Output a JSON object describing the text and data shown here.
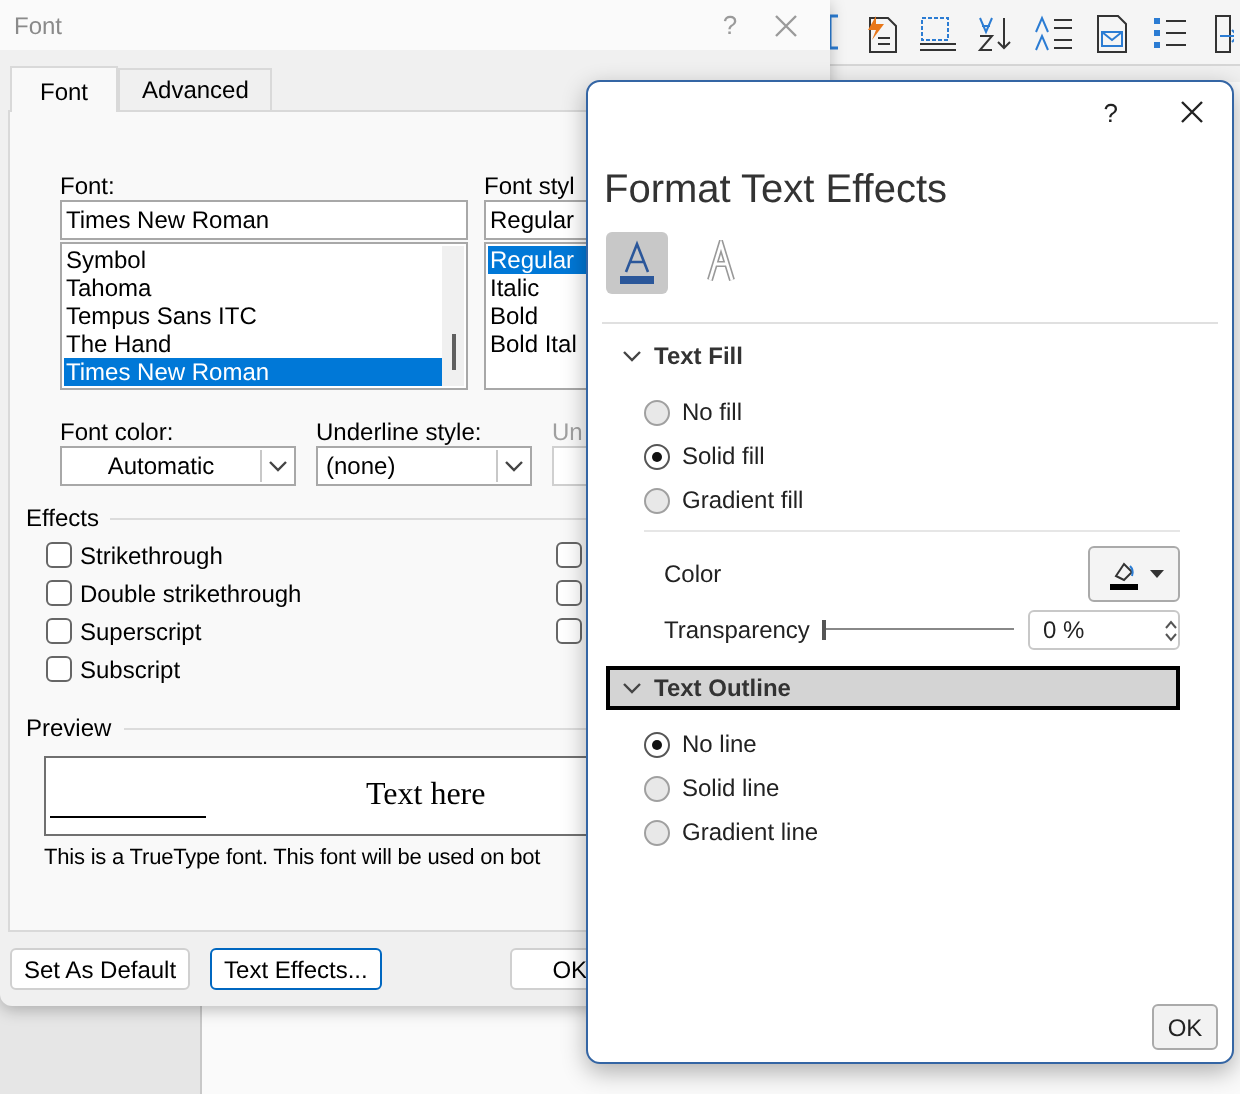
{
  "font_dialog": {
    "title": "Font",
    "help": "?",
    "tabs": [
      {
        "label": "Font",
        "selected": true
      },
      {
        "label": "Advanced",
        "selected": false
      }
    ],
    "font": {
      "label": "Font:",
      "value": "Times New Roman",
      "items": [
        {
          "label": "Symbol",
          "selected": false
        },
        {
          "label": "Tahoma",
          "selected": false
        },
        {
          "label": "Tempus Sans ITC",
          "selected": false
        },
        {
          "label": "The Hand",
          "selected": false
        },
        {
          "label": "Times New Roman",
          "selected": true
        }
      ]
    },
    "font_style": {
      "label": "Font styl",
      "value": "Regular",
      "items": [
        {
          "label": "Regular",
          "selected": true
        },
        {
          "label": "Italic",
          "selected": false
        },
        {
          "label": "Bold",
          "selected": false
        },
        {
          "label": "Bold Ital",
          "selected": false
        }
      ]
    },
    "font_color": {
      "label": "Font color:",
      "value": "Automatic"
    },
    "underline_style": {
      "label": "Underline style:",
      "value": "(none)"
    },
    "underline_color": {
      "label": "Un",
      "disabled": true
    },
    "effects": {
      "title": "Effects",
      "items": [
        {
          "label": "Strikethrough",
          "checked": false
        },
        {
          "label": "Double strikethrough",
          "checked": false
        },
        {
          "label": "Superscript",
          "checked": false
        },
        {
          "label": "Subscript",
          "checked": false
        }
      ],
      "right_items": [
        {
          "checked": false
        },
        {
          "checked": false
        },
        {
          "checked": false
        }
      ]
    },
    "preview": {
      "title": "Preview",
      "sample": "Text here",
      "note": "This is a TrueType font. This font will be used on bot"
    },
    "buttons": [
      {
        "label": "Set As Default",
        "focused": false
      },
      {
        "label": "Text Effects...",
        "focused": true
      },
      {
        "label": "OK",
        "focused": false
      }
    ]
  },
  "effects_pane": {
    "help": "?",
    "title": "Format Text Effects",
    "tabs": [
      {
        "kind": "fill",
        "selected": true
      },
      {
        "kind": "outline",
        "selected": false
      }
    ],
    "sections": [
      {
        "title": "Text Fill",
        "expanded": true,
        "focused": false,
        "options": [
          {
            "label": "No fill",
            "selected": false
          },
          {
            "label": "Solid fill",
            "selected": true
          },
          {
            "label": "Gradient fill",
            "selected": false
          }
        ],
        "color": {
          "label": "Color"
        },
        "transparency": {
          "label": "Transparency",
          "level": 0,
          "reading": "0 %"
        }
      },
      {
        "title": "Text Outline",
        "expanded": true,
        "focused": true,
        "options": [
          {
            "label": "No line",
            "selected": true
          },
          {
            "label": "Solid line",
            "selected": false
          },
          {
            "label": "Gradient line",
            "selected": false
          }
        ]
      }
    ],
    "ok": "OK"
  }
}
